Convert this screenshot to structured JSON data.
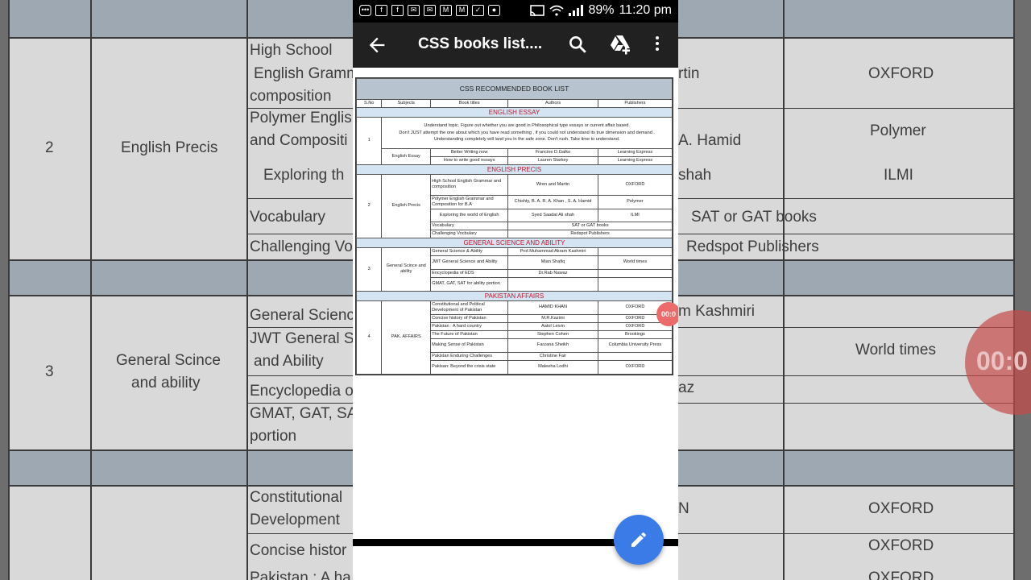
{
  "status_bar": {
    "battery": "89%",
    "time": "11:20 pm"
  },
  "app_bar": {
    "title": "CSS books list...."
  },
  "recording_badge": "00:0",
  "document": {
    "title": "CSS RECOMMENDED BOOK LIST",
    "headers": [
      "S.No",
      "Subjects",
      "Book titles",
      "Authors",
      "Publishers"
    ],
    "sections": {
      "essay": "ENGLISH ESSAY",
      "precis": "ENGLISH PRECIS",
      "science": "GENERAL SCIENCE AND ABILITY",
      "pakistan": "PAKISTAN AFFAIRS"
    },
    "essay": {
      "no": "1",
      "note1": "Understand topic. Figure out whether you are good in Philosophical type essays or current affair based.",
      "note2": "Don't JUST attempt the one about which you have read something , if you could not understand its true dimension and demand .",
      "note3": "Understanding completely will land you in the safe zone. Don't rush. Take time to understand.",
      "subject": "English Essay",
      "rows": [
        {
          "title": "Better Writing now",
          "author": "Francine D.Galko",
          "publisher": "Learning Express"
        },
        {
          "title": "How to write good essays",
          "author": "Lauren Starkey",
          "publisher": "Learning Express"
        }
      ]
    },
    "precis": {
      "no": "2",
      "subject": "English Precis",
      "rows": [
        {
          "title": "High School English Grammar and composition",
          "author": "Wren and Martin",
          "publisher": "OXFORD"
        },
        {
          "title": "Polymer English Grammar and Composition for B.A",
          "author": "Chishty, B. A. R. A. Khan , S. A. Hamid",
          "publisher": "Polymer"
        },
        {
          "title": "Exploring the world of English",
          "author": "Syed Saadat Ali shah",
          "publisher": "ILMI"
        }
      ],
      "vocab": {
        "title": "Vocabulary",
        "note": "SAT or GAT books"
      },
      "challenging": {
        "title": "Challenging Vocbulary",
        "note": "Redspot Publishers"
      }
    },
    "science": {
      "no": "3",
      "subject": "General Scince and ability",
      "rows": [
        {
          "title": "General Science & Ability",
          "author": "Prof.Muhammad Akram Kashmiri",
          "publisher": ""
        },
        {
          "title": "JWT General Science and Ability",
          "author": "Mian Shafiq",
          "publisher": "World times"
        },
        {
          "title": "Encyclopedia of EDS",
          "author": "Dr.Rab Nawaz",
          "publisher": ""
        },
        {
          "title": "GMAT, GAT, SAT for ability portion",
          "author": "",
          "publisher": ""
        }
      ]
    },
    "pakistan": {
      "no": "4",
      "subject": "PAK. AFFAIRS",
      "rows": [
        {
          "title": "Constitutional and Political Development of Pakistan",
          "author": "HAMID KHAN",
          "publisher": "OXFORD"
        },
        {
          "title": "Concise history of Pakistan",
          "author": "M.R.Kazimi",
          "publisher": "OXFORD"
        },
        {
          "title": "Pakistan : A hard country",
          "author": "Aatol Leivin",
          "publisher": "OXFORD"
        },
        {
          "title": "The Future of Pakistan",
          "author": "Stephen Cohen",
          "publisher": "Brookings"
        },
        {
          "title": "Making Sense of Pakistan",
          "author": "Farzana Sheikh",
          "publisher": "Columbia University Press"
        },
        {
          "title": "Pakistan Enduring Challenges",
          "author": "Christine Fair",
          "publisher": ""
        },
        {
          "title": "Pakisan: Beyond the crisis state",
          "author": "Maleeha Lodhi",
          "publisher": "OXFORD"
        }
      ]
    }
  },
  "background": {
    "row2_no": "2",
    "row2_subject": "English Precis",
    "row3_no": "3",
    "row3_subject_a": "General Scince",
    "row3_subject_b": "and ability",
    "c1": "High School",
    "c2": "English Gramm",
    "c3": "composition",
    "c4": "Polymer Englis",
    "c5": "and Compositi",
    "c6": "Exploring th",
    "c7": "Vocabulary",
    "c8": "Challenging Vo",
    "c9": "General Scienc",
    "c10": "JWT General S",
    "c11": "and Ability",
    "c12": "Encyclopedia o",
    "c13": "GMAT, GAT, SA",
    "c14": "portion",
    "c15": "Constitutional",
    "c16": "Development",
    "c17": "Concise histor",
    "c18": "Pakistan : A ha",
    "r1": "rtin",
    "r2": "A. Hamid",
    "r3": "shah",
    "r4": "SAT or GAT books",
    "r5": "Redspot Publishers",
    "r6": "m Kashmiri",
    "r7": "OXFORD",
    "r8": "Polymer",
    "r9": "ILMI",
    "r10": "World times",
    "r11": "OXFORD",
    "r12": "OXFORD",
    "r13": "OXFORD",
    "r14": "N",
    "r15": "az",
    "rec": "00:0"
  }
}
